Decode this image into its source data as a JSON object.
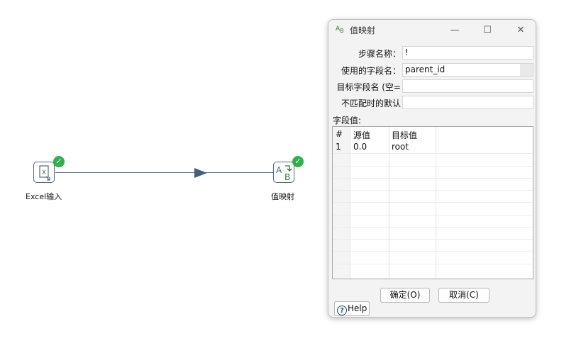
{
  "canvas": {
    "steps": [
      {
        "label": "Excel输入",
        "icon": "excel-file-icon",
        "status": "ok"
      },
      {
        "label": "值映射",
        "icon": "value-mapper-icon",
        "status": "ok"
      }
    ],
    "hop_color": "#3f617f",
    "ok_color": "#2fb24a"
  },
  "dialog": {
    "title": "值映射",
    "title_icon_text": "AB",
    "window_buttons": {
      "minimize": "—",
      "maximize": "☐",
      "close": "✕"
    },
    "form": {
      "step_name_label": "步骤名称：",
      "step_name_value": "!",
      "field_to_use_label": "使用的字段名：",
      "field_to_use_value": "parent_id",
      "target_field_label": "目标字段名 (空=",
      "target_field_value": "",
      "default_label": "不匹配时的默认",
      "default_value": ""
    },
    "field_values_label": "字段值:",
    "table": {
      "columns": [
        "#",
        "源值",
        "目标值"
      ],
      "rows": [
        {
          "num": "1",
          "source": "0.0",
          "target": "root"
        }
      ]
    },
    "buttons": {
      "ok": "确定(O)",
      "cancel": "取消(C)",
      "help": "Help"
    }
  }
}
